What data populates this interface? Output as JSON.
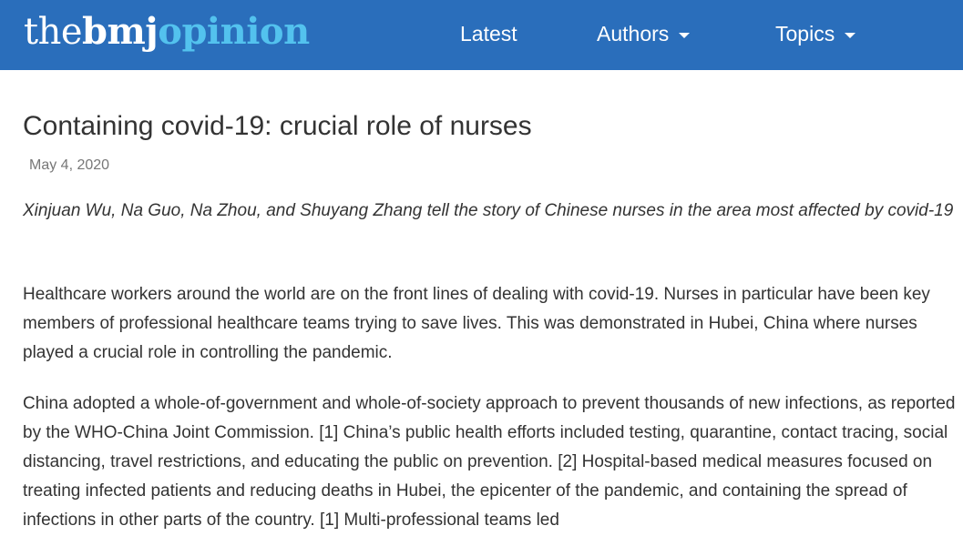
{
  "header": {
    "logo": {
      "the": "the",
      "bmj": "bmj",
      "opinion": "opinion"
    },
    "nav": {
      "latest": "Latest",
      "authors": "Authors",
      "topics": "Topics"
    },
    "colors": {
      "background": "#2a6ebb",
      "logo_accent": "#53c2ee",
      "text": "#ffffff"
    }
  },
  "article": {
    "title": "Containing covid-19: crucial role of nurses",
    "date": "May 4, 2020",
    "standfirst": "Xinjuan Wu, Na Guo, Na Zhou, and Shuyang Zhang tell the story of Chinese nurses in the area most affected by covid-19",
    "paragraphs": [
      "Healthcare workers around the world are on the front lines of dealing with covid-19. Nurses in particular have been key members of professional healthcare teams trying to save lives. This was demonstrated in Hubei, China where nurses played a crucial role in controlling the pandemic.",
      "China adopted a whole-of-government and whole-of-society approach to prevent thousands of new infections, as reported by the WHO-China Joint Commission. [1] China’s public health efforts included testing, quarantine, contact tracing, social distancing, travel restrictions, and educating the public on prevention. [2] Hospital-based medical measures focused on treating infected patients and reducing deaths in Hubei, the epicenter of the pandemic, and containing the spread of infections in other parts of the country. [1] Multi-professional teams led"
    ]
  }
}
